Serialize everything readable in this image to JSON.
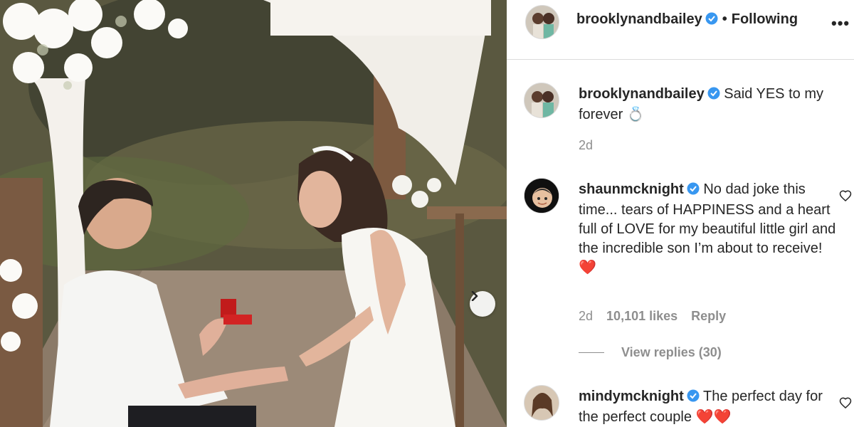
{
  "post": {
    "photo_alt": "",
    "next_icon": "chevron-right-icon"
  },
  "header": {
    "username": "brooklynandbailey",
    "verified": true,
    "separator": "•",
    "follow_status": "Following",
    "more_icon": "•••"
  },
  "caption": {
    "username": "brooklynandbailey",
    "text": "Said YES to my forever 💍",
    "time": "2d"
  },
  "comments": [
    {
      "username": "shaunmcknight",
      "text": "No dad joke this time... tears of HAPPINESS and a heart full of LOVE for my beautiful little girl and the incredible son I’m about to receive!",
      "emoji": "❤️",
      "time": "2d",
      "likes": "10,101 likes",
      "reply": "Reply",
      "view_replies": "View replies (30)"
    },
    {
      "username": "mindymcknight",
      "text": "The perfect day for the perfect couple",
      "emoji": "❤️❤️"
    }
  ],
  "colors": {
    "verified": "#3897f0",
    "muted": "#8e8e8e",
    "text": "#262626",
    "heart": "#ed1c24"
  }
}
